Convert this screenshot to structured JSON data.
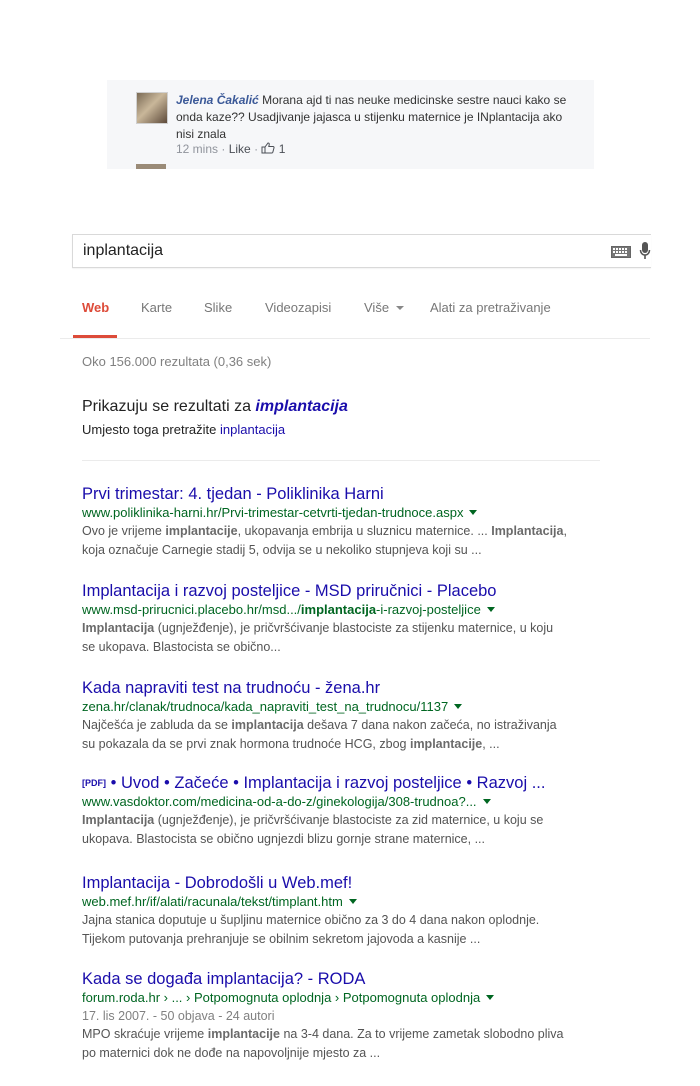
{
  "facebook_comment": {
    "author": "Jelena Čakalić",
    "text": "Morana ajd ti nas neuke medicinske sestre nauci kako se onda kaze?? Usadjivanje jajasca u stijenku maternice je INplantacija ako nisi znala",
    "time": "12 mins",
    "separator": "·",
    "like_label": "Like",
    "like_count": "1"
  },
  "search": {
    "query": "inplantacija"
  },
  "tabs": [
    {
      "label": "Web",
      "active": true
    },
    {
      "label": "Karte",
      "active": false
    },
    {
      "label": "Slike",
      "active": false
    },
    {
      "label": "Videozapisi",
      "active": false
    },
    {
      "label": "Više",
      "active": false
    },
    {
      "label": "Alati za pretraživanje",
      "active": false
    }
  ],
  "stats": "Oko 156.000 rezultata (0,36 sek)",
  "correction": {
    "showing_prefix": "Prikazuju se rezultati za",
    "corrected_query": "implantacija",
    "instead_prefix": "Umjesto toga pretražite",
    "original_query": "inplantacija"
  },
  "results": [
    {
      "title": "Prvi trimestar: 4. tjedan - Poliklinika Harni",
      "url": "www.poliklinika-harni.hr/Prvi-trimestar-cetvrti-tjedan-trudnoce.aspx",
      "snippet_1a": "Ovo je vrijeme ",
      "snippet_1b": "implantacije",
      "snippet_1c": ", ukopavanja embrija u sluznicu maternice. ... ",
      "snippet_1d": "Implantacija",
      "snippet_1e": ",",
      "snippet_2": "koja označuje Carnegie stadij 5, odvija se u nekoliko stupnjeva koji su  ..."
    },
    {
      "title": "Implantacija i razvoj posteljice - MSD priručnici - Placebo",
      "url_a": "www.msd-prirucnici.placebo.hr/msd.../",
      "url_b": "implantacija",
      "url_c": "-i-razvoj-posteljice",
      "snippet_1a": "Implantacija",
      "snippet_1b": " (ugnježđenje), je pričvršćivanje blastociste za stijenku maternice, u koju",
      "snippet_2": "se ukopava. Blastocista se obično..."
    },
    {
      "title": "Kada napraviti test na trudnoću - žena.hr",
      "url": "zena.hr/clanak/trudnoca/kada_napraviti_test_na_trudnocu/1137",
      "snippet_1a": "Najčešća je zabluda da se ",
      "snippet_1b": "implantacija",
      "snippet_1c": " dešava 7 dana nakon začeća, no istraživanja",
      "snippet_2a": "su pokazala da se prvi znak hormona trudnoće HCG, zbog ",
      "snippet_2b": "implantacije",
      "snippet_2c": ",  ..."
    },
    {
      "pdf_label": "[PDF]",
      "title": "• Uvod • Začeće • Implantacija i razvoj posteljice • Razvoj ...",
      "url": "www.vasdoktor.com/medicina-od-a-do-z/ginekologija/308-trudnoa?...",
      "snippet_1a": "Implantacija",
      "snippet_1b": " (ugnježđenje), je pričvršćivanje blastociste za zid maternice, u koju se",
      "snippet_2": "ukopava. Blastocista se obično ugnjezdi blizu gornje strane maternice, ..."
    },
    {
      "title": "Implantacija - Dobrodošli u Web.mef!",
      "url": "web.mef.hr/if/alati/racunala/tekst/timplant.htm",
      "snippet_1": "Jajna stanica doputuje u šupljinu maternice obično za 3 do 4 dana nakon oplodnje.",
      "snippet_2": "Tijekom putovanja prehranjuje se obilnim sekretom jajovoda a kasnije ..."
    },
    {
      "title": "Kada se događa implantacija? - RODA",
      "url": "forum.roda.hr › ... › Potpomognuta oplodnja › Potpomognuta oplodnja",
      "meta": "17. lis 2007. - 50 objava - 24 autori",
      "snippet_1a": "MPO skraćuje vrijeme ",
      "snippet_1b": "implantacije",
      "snippet_1c": " na 3-4 dana. Za to vrijeme zametak slobodno pliva",
      "snippet_2": "po maternici dok ne dođe na napovoljnije mjesto za ..."
    }
  ]
}
